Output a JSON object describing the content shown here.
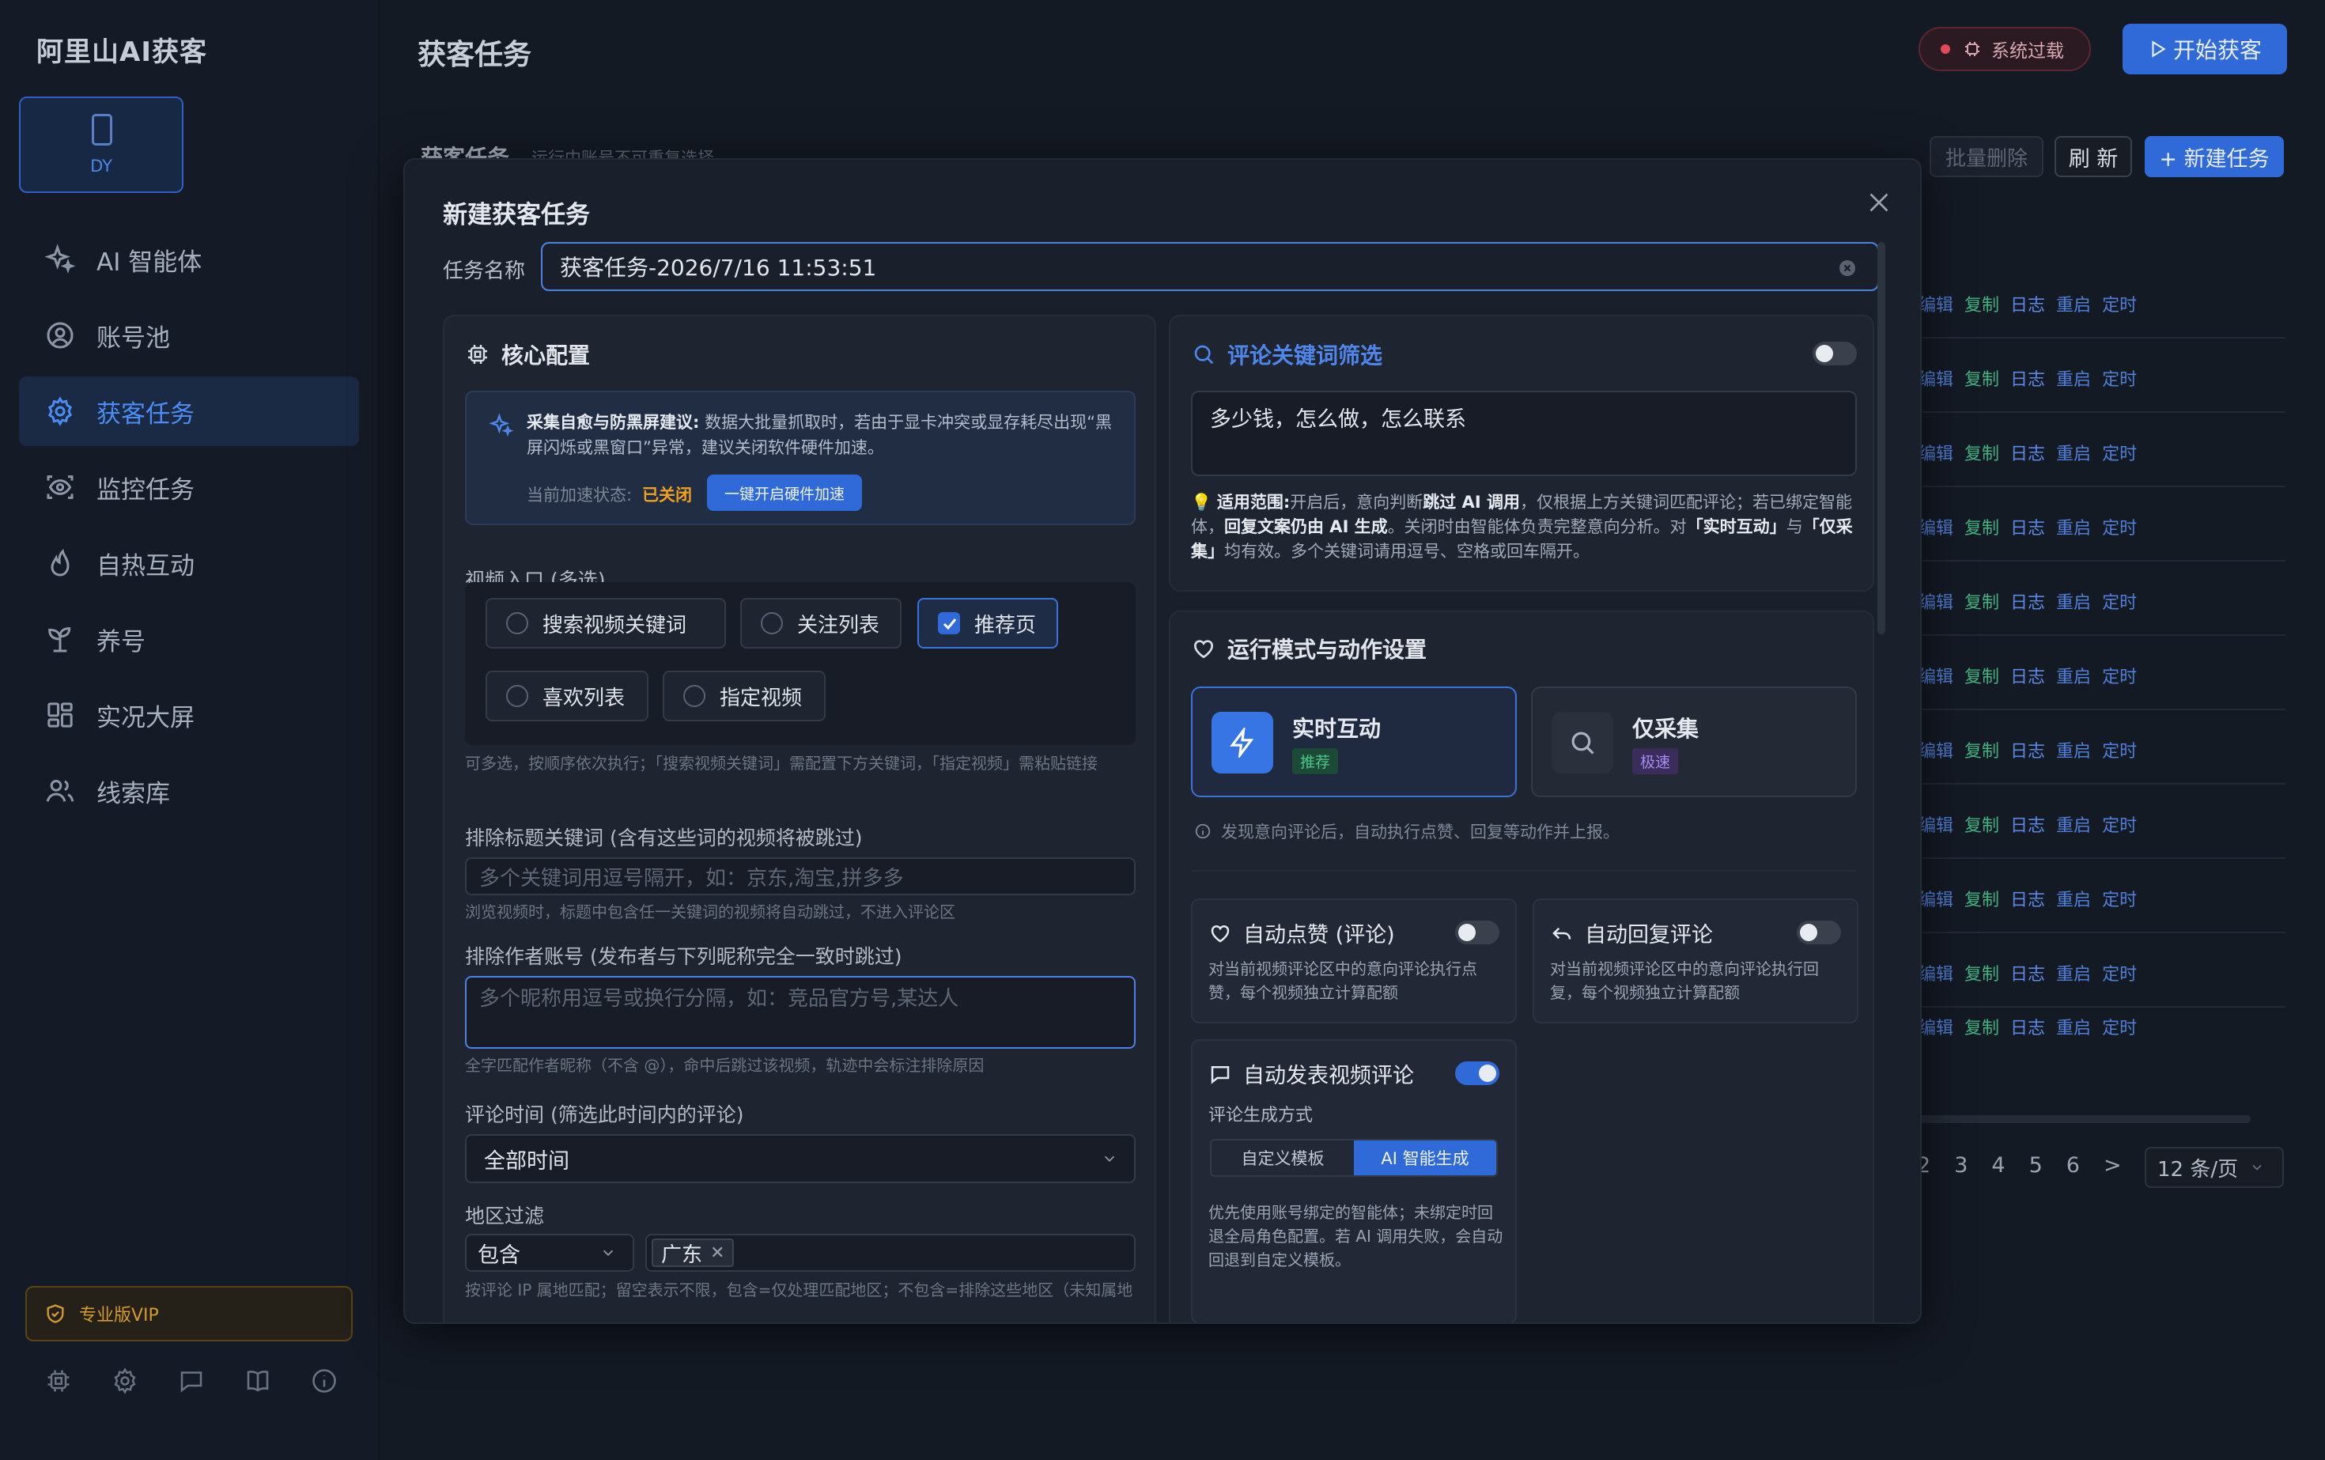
{
  "app": {
    "brand": "阿里山AI获客",
    "device_label": "DY"
  },
  "sidebar": {
    "items": [
      {
        "label": "AI 智能体",
        "icon": "sparkle-icon",
        "active": false
      },
      {
        "label": "账号池",
        "icon": "user-circle-icon",
        "active": false
      },
      {
        "label": "获客任务",
        "icon": "gear-icon",
        "active": true
      },
      {
        "label": "监控任务",
        "icon": "scan-eye-icon",
        "active": false
      },
      {
        "label": "自热互动",
        "icon": "flame-icon",
        "active": false
      },
      {
        "label": "养号",
        "icon": "sprout-icon",
        "active": false
      },
      {
        "label": "实况大屏",
        "icon": "grid-icon",
        "active": false
      },
      {
        "label": "线索库",
        "icon": "users-icon",
        "active": false
      }
    ],
    "vip_label": "专业版VIP",
    "tools": [
      "chip-icon",
      "settings-icon",
      "chat-icon",
      "book-icon",
      "info-icon"
    ]
  },
  "header": {
    "title": "获客任务",
    "system_status": "系统过载",
    "start_button": "开始获客"
  },
  "task_list": {
    "title": "获客任务",
    "hint": "运行中账号不可重复选择",
    "batch_delete": "批量删除",
    "refresh": "刷 新",
    "new_task": "+ 新建任务",
    "row_actions": [
      "编辑",
      "复制",
      "日志",
      "重启",
      "定时"
    ],
    "row_count": 11,
    "pages": [
      "2",
      "3",
      "4",
      "5",
      "6"
    ],
    "next": ">",
    "page_size": "12 条/页"
  },
  "modal": {
    "title": "新建获客任务",
    "name_label": "任务名称",
    "name_value": "获客任务-2026/7/16 11:53:51",
    "core": {
      "title": "核心配置",
      "notice_title": "采集自愈与防黑屏建议:",
      "notice_text": "数据大批量抓取时，若由于显卡冲突或显存耗尽出现“黑屏闪烁或黑窗口”异常，建议关闭软件硬件加速。",
      "accel_label": "当前加速状态:",
      "accel_value": "已关闭",
      "accel_button": "一键开启硬件加速",
      "entry_label": "视频入口 (多选)",
      "entries": [
        {
          "label": "搜索视频关键词",
          "checked": false
        },
        {
          "label": "关注列表",
          "checked": false
        },
        {
          "label": "推荐页",
          "checked": true
        },
        {
          "label": "喜欢列表",
          "checked": false
        },
        {
          "label": "指定视频",
          "checked": false
        }
      ],
      "entry_hint": "可多选，按顺序依次执行；「搜索视频关键词」需配置下方关键词，「指定视频」需粘贴链接",
      "exclude_title_label": "排除标题关键词 (含有这些词的视频将被跳过)",
      "exclude_title_placeholder": "多个关键词用逗号隔开，如：京东,淘宝,拼多多",
      "exclude_title_hint": "浏览视频时，标题中包含任一关键词的视频将自动跳过，不进入评论区",
      "exclude_author_label": "排除作者账号 (发布者与下列昵称完全一致时跳过)",
      "exclude_author_placeholder": "多个昵称用逗号或换行分隔，如：竞品官方号,某达人",
      "exclude_author_hint": "全字匹配作者昵称（不含 @），命中后跳过该视频，轨迹中会标注排除原因",
      "time_label": "评论时间 (筛选此时间内的评论)",
      "time_value": "全部时间",
      "region_label": "地区过滤",
      "region_mode": "包含",
      "region_tag": "广东",
      "region_hint": "按评论 IP 属地匹配；留空表示不限，包含=仅处理匹配地区；不包含=排除这些地区（未知属地"
    },
    "keyword_filter": {
      "title": "评论关键词筛选",
      "enabled": false,
      "keywords": "多少钱，怎么做，怎么联系",
      "scope_label": "适用范围:",
      "scope_text_1": "开启后，意向判断",
      "scope_bold_1": "跳过 AI 调用",
      "scope_text_2": "，仅根据上方关键词匹配评论；若已绑定智能体，",
      "scope_bold_2": "回复文案仍由 AI 生成",
      "scope_text_3": "。关闭时由智能体负责完整意向分析。对",
      "scope_bold_3": "「实时互动」",
      "scope_text_4": "与",
      "scope_bold_4": "「仅采集」",
      "scope_text_5": "均有效。多个关键词请用逗号、空格或回车隔开。"
    },
    "run_mode": {
      "title": "运行模式与动作设置",
      "modes": [
        {
          "label": "实时互动",
          "badge": "推荐",
          "icon": "lightning-icon",
          "selected": true,
          "badge_color": "#2a9a64"
        },
        {
          "label": "仅采集",
          "badge": "极速",
          "icon": "search-icon",
          "selected": false,
          "badge_color": "#8a63d2"
        }
      ],
      "mode_desc": "发现意向评论后，自动执行点赞、回复等动作并上报。",
      "auto_like": {
        "title": "自动点赞 (评论)",
        "desc": "对当前视频评论区中的意向评论执行点赞，每个视频独立计算配额",
        "enabled": false
      },
      "auto_reply": {
        "title": "自动回复评论",
        "desc": "对当前视频评论区中的意向评论执行回复，每个视频独立计算配额",
        "enabled": false
      },
      "auto_comment": {
        "title": "自动发表视频评论",
        "enabled": true,
        "gen_label": "评论生成方式",
        "gen_options": [
          "自定义模板",
          "AI 智能生成"
        ],
        "gen_selected": "AI 智能生成",
        "desc": "优先使用账号绑定的智能体；未绑定时回退全局角色配置。若 AI 调用失败，会自动回退到自定义模板。"
      }
    }
  }
}
